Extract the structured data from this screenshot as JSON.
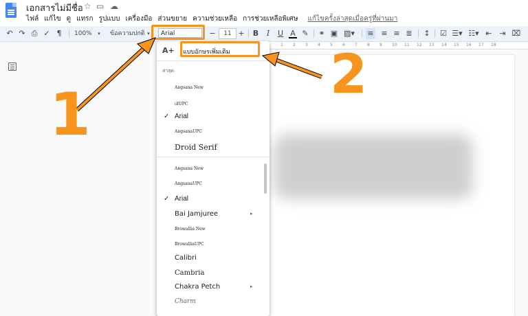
{
  "header": {
    "doc_title": "เอกสารไม่มีชื่อ",
    "star_icon": "star-icon",
    "move_icon": "folder-move-icon",
    "cloud_icon": "cloud-status-icon",
    "menu": [
      "ไฟล์",
      "แก้ไข",
      "ดู",
      "แทรก",
      "รูปแบบ",
      "เครื่องมือ",
      "ส่วนขยาย",
      "ความช่วยเหลือ",
      "การช่วยเหลือพิเศษ"
    ],
    "last_edit": "แก้ไขครั้งล่าสุดเมื่อครู่ที่ผ่านมา"
  },
  "toolbar": {
    "zoom": "100%",
    "style": "ข้อความปกติ",
    "font": "Arial",
    "font_size": "11",
    "minus": "−",
    "plus": "+",
    "bold": "B",
    "italic": "I",
    "underline": "U",
    "text_color": "A"
  },
  "ruler": [
    "1",
    "2",
    "3",
    "4",
    "5",
    "6",
    "7",
    "8",
    "9",
    "10",
    "11",
    "12",
    "13",
    "14",
    "15",
    "16",
    "17",
    "18"
  ],
  "dropdown": {
    "more_fonts_label": "แบบอักษรเพิ่มเติม",
    "recent_header": "ล่าสุด",
    "recent": [
      {
        "name": "Angsana New",
        "checked": false,
        "submenu": false
      },
      {
        "name": "เฮ้UPC",
        "checked": false,
        "submenu": false
      },
      {
        "name": "Arial",
        "checked": true,
        "submenu": false
      },
      {
        "name": "AngsanaUPC",
        "checked": false,
        "submenu": false
      },
      {
        "name": "Droid Serif",
        "checked": false,
        "submenu": false
      }
    ],
    "all": [
      {
        "name": "Angsana New",
        "checked": false,
        "submenu": false
      },
      {
        "name": "AngsanaUPC",
        "checked": false,
        "submenu": false
      },
      {
        "name": "Arial",
        "checked": true,
        "submenu": false
      },
      {
        "name": "Bai Jamjuree",
        "checked": false,
        "submenu": true
      },
      {
        "name": "Browallia New",
        "checked": false,
        "submenu": false
      },
      {
        "name": "BrowalliaUPC",
        "checked": false,
        "submenu": false
      },
      {
        "name": "Calibri",
        "checked": false,
        "submenu": false
      },
      {
        "name": "Cambria",
        "checked": false,
        "submenu": false
      },
      {
        "name": "Chakra Petch",
        "checked": false,
        "submenu": true
      },
      {
        "name": "Charm",
        "checked": false,
        "submenu": false
      }
    ]
  },
  "annotations": {
    "step1": "1",
    "step2": "2",
    "color": "#f7941d"
  }
}
